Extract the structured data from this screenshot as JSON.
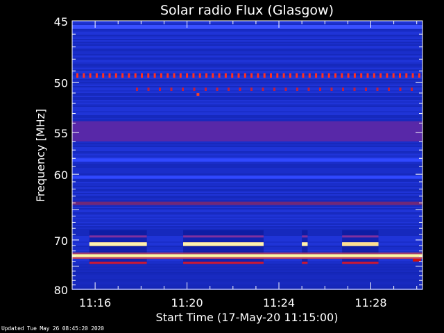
{
  "chart_data": {
    "type": "heatmap",
    "title": "Solar radio Flux (Glasgow)",
    "xlabel": "Start Time (17-May-20 11:15:00)",
    "ylabel": "Frequency [MHz]",
    "x_range_minutes": [
      "11:15:00",
      "11:30:15"
    ],
    "x_ticks": [
      "11:16",
      "11:20",
      "11:24",
      "11:28"
    ],
    "y_range_mhz": [
      45,
      80
    ],
    "y_ticks": [
      45,
      50,
      55,
      60,
      70,
      80
    ],
    "y_ticks_unlabeled": [
      65,
      75
    ],
    "colormap": [
      "#000060",
      "#1020d0",
      "#3040ff",
      "#802080",
      "#c01030",
      "#ff6030",
      "#ffff80",
      "#ffffff"
    ],
    "background_color": "#1a2fd0",
    "bands": [
      {
        "f_from": 45.3,
        "f_to": 45.6,
        "intensity": "strong-blue",
        "color": "#3a50ff"
      },
      {
        "f_from": 49.2,
        "f_to": 49.6,
        "intensity": "periodic-red",
        "color": "#ff3020"
      },
      {
        "f_from": 50.5,
        "f_to": 50.8,
        "intensity": "periodic-red-weak",
        "color": "#c02040"
      },
      {
        "f_from": 53.8,
        "f_to": 56.0,
        "intensity": "purple",
        "color": "#5828a8"
      },
      {
        "f_from": 58.0,
        "f_to": 58.4,
        "intensity": "strong-blue",
        "color": "#3048ff"
      },
      {
        "f_from": 60.2,
        "f_to": 60.6,
        "intensity": "strong-blue",
        "color": "#3048ff"
      },
      {
        "f_from": 63.8,
        "f_to": 64.3,
        "intensity": "purple",
        "color": "#702878"
      },
      {
        "f_from": 72.6,
        "f_to": 73.2,
        "intensity": "saturated",
        "color": "#fff8a0"
      }
    ],
    "bursts": [
      {
        "t_from": "11:15:45",
        "t_to": "11:18:15",
        "f_center": 70.7,
        "color": "#fff4b0"
      },
      {
        "t_from": "11:19:50",
        "t_to": "11:23:20",
        "f_center": 70.7,
        "color": "#fff4b0"
      },
      {
        "t_from": "11:25:00",
        "t_to": "11:25:15",
        "f_center": 70.7,
        "color": "#fff4b0"
      },
      {
        "t_from": "11:26:45",
        "t_to": "11:28:20",
        "f_center": 70.7,
        "color": "#ffe090"
      }
    ],
    "grid": false,
    "legend": "none"
  },
  "footer": {
    "updated": "Updated Tue May 26 08:45:20 2020"
  }
}
